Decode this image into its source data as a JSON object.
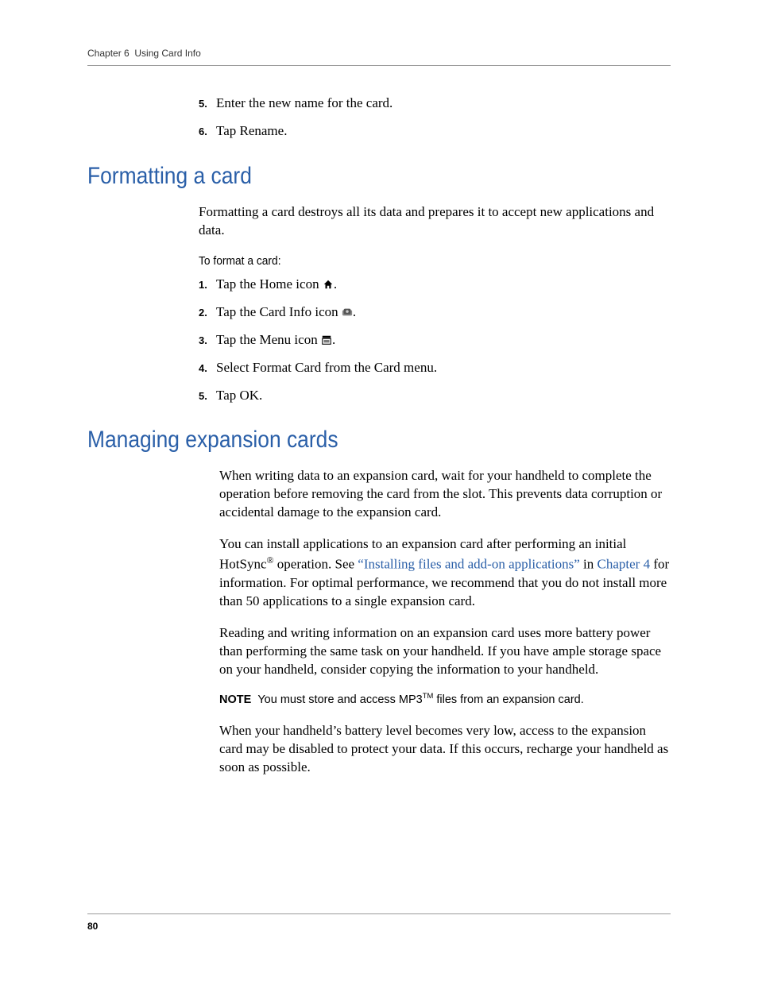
{
  "header": {
    "chapter_label": "Chapter 6",
    "chapter_title": "Using Card Info"
  },
  "intro_steps": [
    {
      "num": "5.",
      "text": "Enter the new name for the card."
    },
    {
      "num": "6.",
      "text": "Tap Rename."
    }
  ],
  "formatting": {
    "heading": "Formatting a card",
    "intro": "Formatting a card destroys all its data and prepares it to accept new applications and data.",
    "sub": "To format a card:",
    "steps": [
      {
        "num": "1.",
        "before": "Tap the Home icon ",
        "icon": "home",
        "after": "."
      },
      {
        "num": "2.",
        "before": "Tap the Card Info icon ",
        "icon": "cardinfo",
        "after": "."
      },
      {
        "num": "3.",
        "before": "Tap the Menu icon ",
        "icon": "menu",
        "after": "."
      },
      {
        "num": "4.",
        "before": "Select Format Card from the Card menu.",
        "icon": "",
        "after": ""
      },
      {
        "num": "5.",
        "before": "Tap OK.",
        "icon": "",
        "after": ""
      }
    ]
  },
  "managing": {
    "heading": "Managing expansion cards",
    "p1": "When writing data to an expansion card, wait for your handheld to complete the operation before removing the card from the slot. This prevents data corruption or accidental damage to the expansion card.",
    "p2_a": "You can install applications to an expansion card after performing an initial HotSync",
    "p2_reg": "®",
    "p2_b": " operation. See ",
    "p2_link1": "“Installing files and add-on applications”",
    "p2_c": " in ",
    "p2_link2": "Chapter 4",
    "p2_d": " for information. For optimal performance, we recommend that you do not install more than 50 applications to a single expansion card.",
    "p3": "Reading and writing information on an expansion card uses more battery power than performing the same task on your handheld. If you have ample storage space on your handheld, consider copying the information to your handheld.",
    "note_label": "NOTE",
    "note_a": "You must store and access MP3",
    "note_tm": "TM",
    "note_b": " files from an expansion card.",
    "p4": "When your handheld’s battery level becomes very low, access to the expansion card may be disabled to protect your data. If this occurs, recharge your handheld as soon as possible."
  },
  "footer": {
    "page": "80"
  }
}
